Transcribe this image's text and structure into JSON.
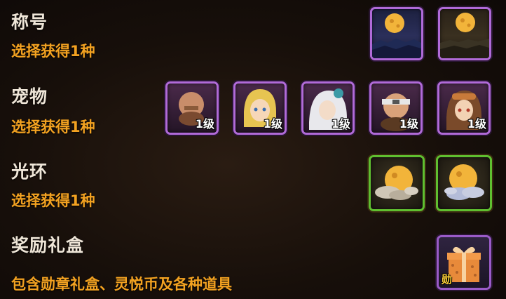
{
  "sections": [
    {
      "title": "称号",
      "desc": "选择获得1种"
    },
    {
      "title": "宠物",
      "desc": "选择获得1种"
    },
    {
      "title": "光环",
      "desc": "选择获得1种"
    },
    {
      "title": "奖励礼盒",
      "desc": "包含勋章礼盒、灵悦币及各种道具"
    }
  ],
  "titles_items": [
    {
      "icon": "full-moon-night-icon"
    },
    {
      "icon": "full-moon-dusk-icon"
    }
  ],
  "pets": [
    {
      "icon": "bald-warrior-pet-icon",
      "level": "1级"
    },
    {
      "icon": "blonde-girl-pet-icon",
      "level": "1级"
    },
    {
      "icon": "white-hair-pet-icon",
      "level": "1级"
    },
    {
      "icon": "headband-man-pet-icon",
      "level": "1级"
    },
    {
      "icon": "goggles-girl-pet-icon",
      "level": "1级"
    }
  ],
  "auras": [
    {
      "icon": "moon-cloud-aura-icon"
    },
    {
      "icon": "moon-cloud-aura-icon"
    }
  ],
  "gift": {
    "icon": "gift-box-icon",
    "mark": "勋"
  },
  "colors": {
    "title": "#efe6d8",
    "desc": "#f3a221",
    "purple_frame": "#b06ad8",
    "green_frame": "#5fbf30"
  }
}
